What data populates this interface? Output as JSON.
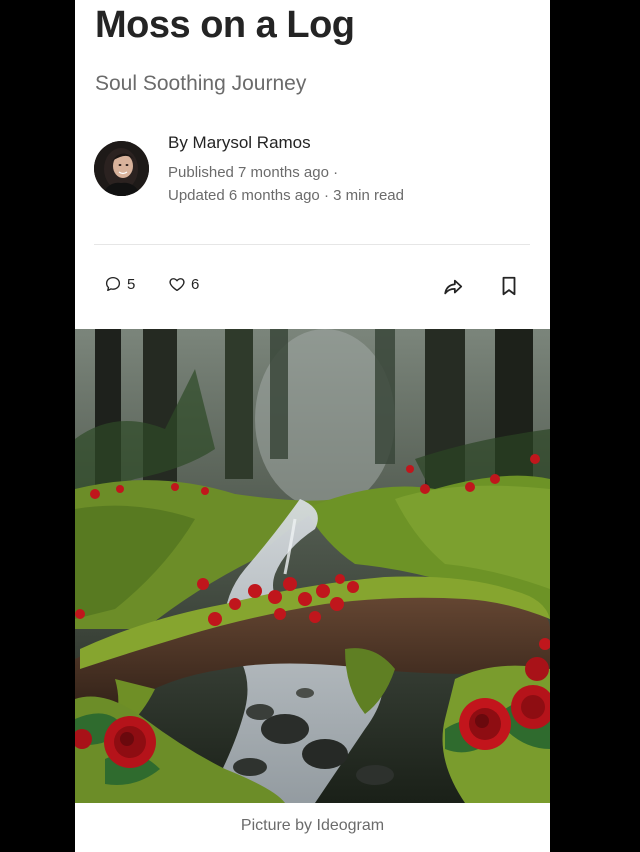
{
  "article": {
    "title": "Moss on a Log",
    "subtitle": "Soul Soothing Journey",
    "author": "By Marysol Ramos",
    "published": "Published 7 months ago ·",
    "updated": "Updated 6 months ago · 3 min read"
  },
  "actions": {
    "comments_count": "5",
    "likes_count": "6",
    "icons": {
      "comments": "comment-icon",
      "likes": "heart-icon",
      "share": "share-icon",
      "bookmark": "bookmark-icon"
    }
  },
  "image": {
    "caption": "Picture by Ideogram",
    "description_icon": "forest-stream-illustration"
  },
  "colors": {
    "background": "#000000",
    "page": "#ffffff",
    "title": "#242424",
    "muted": "#6b6b6b",
    "divider": "#e6e6e6",
    "moss": "#6f8f2a",
    "rose": "#c8161d"
  }
}
